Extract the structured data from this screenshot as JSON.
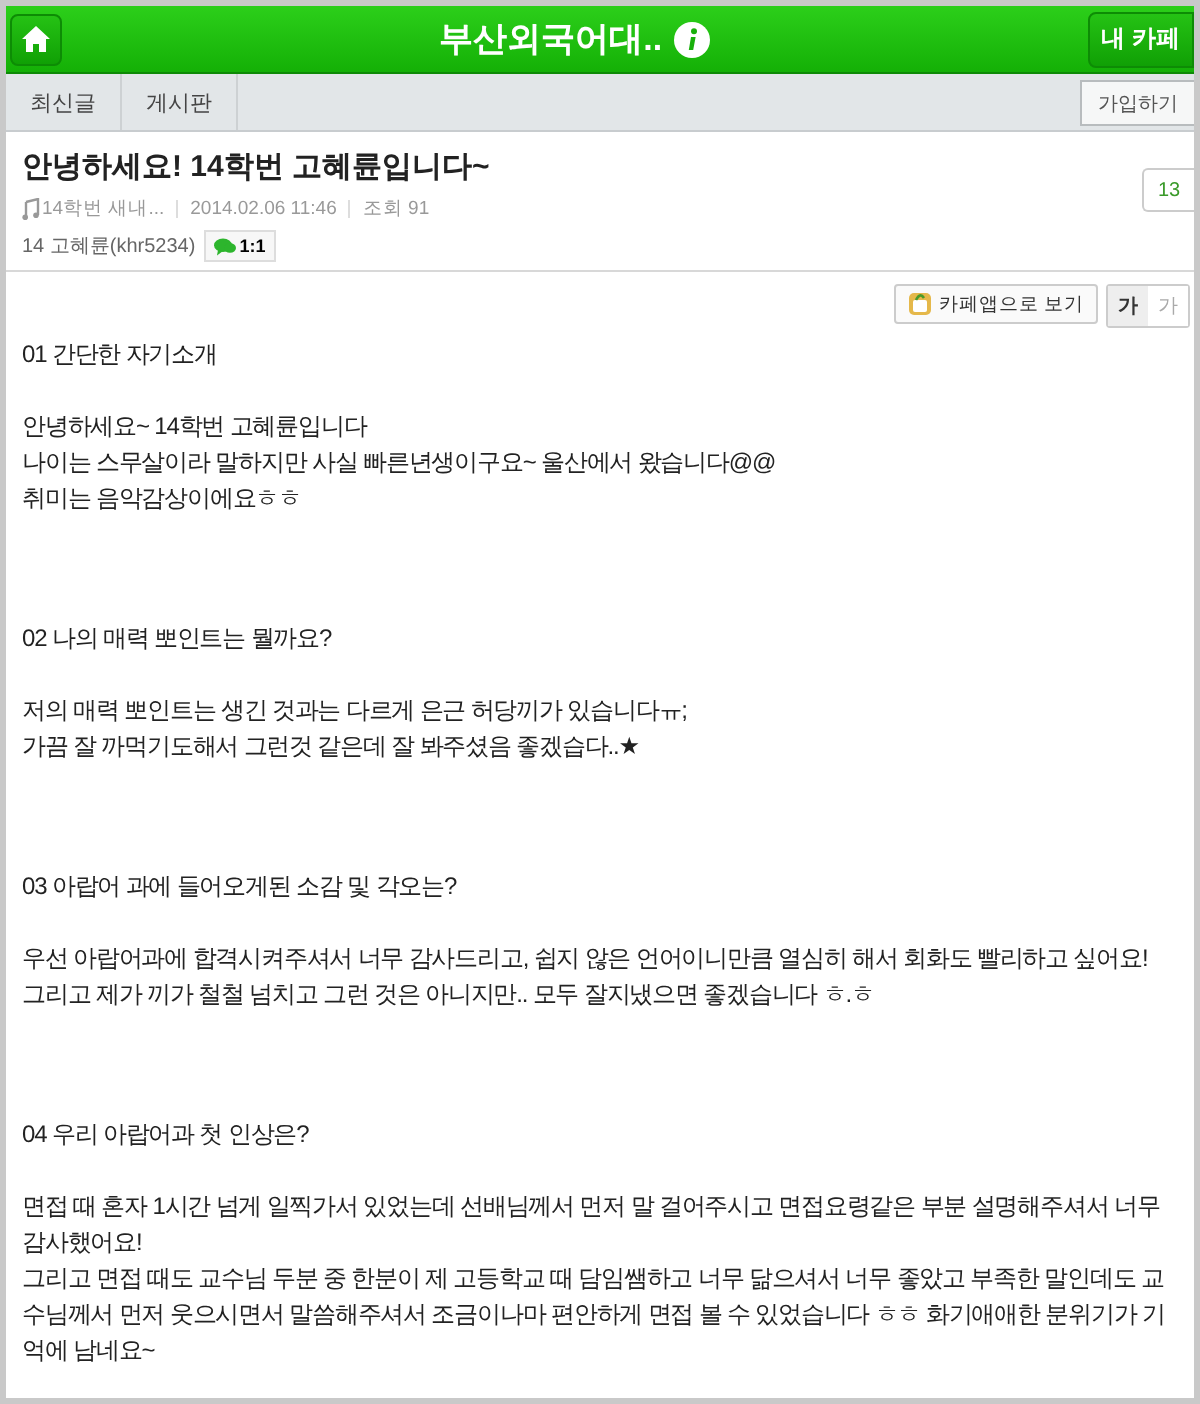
{
  "header": {
    "title": "부산외국어대..",
    "my_cafe": "내 카페"
  },
  "tabs": [
    {
      "label": "최신글",
      "selected": false
    },
    {
      "label": "게시판",
      "selected": false
    }
  ],
  "join": "가입하기",
  "post": {
    "title": "안녕하세요! 14학번 고혜륜입니다~",
    "board": "14학번 새내...",
    "date": "2014.02.06 11:46",
    "views": "조회 91",
    "author": "14 고혜륜(khr5234)",
    "chat": "1:1",
    "comments": "13"
  },
  "app_view": "카페앱으로 보기",
  "font_sizes": [
    {
      "label": "가",
      "selected": true
    },
    {
      "label": "가",
      "selected": false
    }
  ],
  "body": [
    {
      "kind": "heading",
      "lines": [
        "01 간단한 자기소개"
      ]
    },
    {
      "kind": "text",
      "lines": [
        "안녕하세요~ 14학번 고혜륜입니다",
        "나이는 스무살이라 말하지만 사실 빠른년생이구요~ 울산에서 왔습니다@@",
        "취미는 음악감상이에요ㅎㅎ"
      ]
    },
    {
      "kind": "heading",
      "lines": [
        "02 나의 매력 뽀인트는 뭘까요?"
      ]
    },
    {
      "kind": "text",
      "lines": [
        "저의 매력 뽀인트는 생긴 것과는 다르게 은근 허당끼가 있습니다ㅠ;",
        "가끔 잘 까먹기도해서 그런것 같은데 잘 봐주셨음 좋겠습다..★"
      ]
    },
    {
      "kind": "heading",
      "lines": [
        "03 아랍어 과에 들어오게된 소감 및 각오는?"
      ]
    },
    {
      "kind": "text",
      "lines": [
        "우선 아랍어과에 합격시켜주셔서 너무 감사드리고, 쉽지 않은 언어이니만큼 열심히 해서 회화도 빨리하고 싶어요!",
        "그리고 제가 끼가 철철 넘치고 그런 것은 아니지만.. 모두 잘지냈으면 좋겠습니다 ㅎ.ㅎ"
      ]
    },
    {
      "kind": "heading",
      "lines": [
        "04 우리 아랍어과 첫 인상은?"
      ]
    },
    {
      "kind": "text",
      "lines": [
        "면접 때 혼자 1시간 넘게 일찍가서 있었는데 선배님께서 먼저 말 걸어주시고 면접요령같은 부분 설명해주셔서 너무 감사했어요!",
        "그리고 면접 때도 교수님 두분 중 한분이 제 고등학교 때 담임쌤하고 너무 닮으셔서 너무 좋았고 부족한 말인데도 교수님께서 먼저 웃으시면서 말씀해주셔서 조금이나마 편안하게 면접 볼 수 있었습니다 ㅎㅎ 화기애애한 분위기가 기억에 남네요~"
      ]
    }
  ]
}
